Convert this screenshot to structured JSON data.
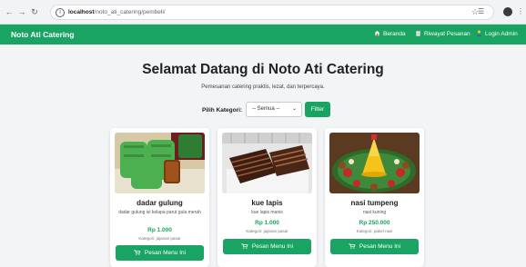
{
  "browser": {
    "url_host": "localhost",
    "url_path": "/noto_ati_catering/pembeli/"
  },
  "navbar": {
    "brand": "Noto Ati Catering",
    "links": [
      "Beranda",
      "Riwayat Pesanan",
      "Login Admin"
    ]
  },
  "hero": {
    "title": "Selamat Datang di Noto Ati Catering",
    "subtitle": "Pemesanan catering praktis, lezat, dan terpercaya."
  },
  "filter": {
    "label": "Pilih Kategori:",
    "selected": "-- Semua --",
    "button": "Filter"
  },
  "menus": [
    {
      "name": "dadar gulung",
      "desc": "dadar gulung isi kelapa parut gula merah",
      "price": "Rp 1.000",
      "category": "Kategori: jajanan pasar",
      "button": "Pesan Menu Ini"
    },
    {
      "name": "kue lapis",
      "desc": "kue lapis manis",
      "price": "Rp 1.000",
      "category": "Kategori: jajanan pasar",
      "button": "Pesan Menu Ini"
    },
    {
      "name": "nasi tumpeng",
      "desc": "nasi kuning",
      "price": "Rp 250.000",
      "category": "Kategori: paket nasi",
      "button": "Pesan Menu Ini"
    }
  ],
  "colors": {
    "primary": "#1aa463"
  }
}
